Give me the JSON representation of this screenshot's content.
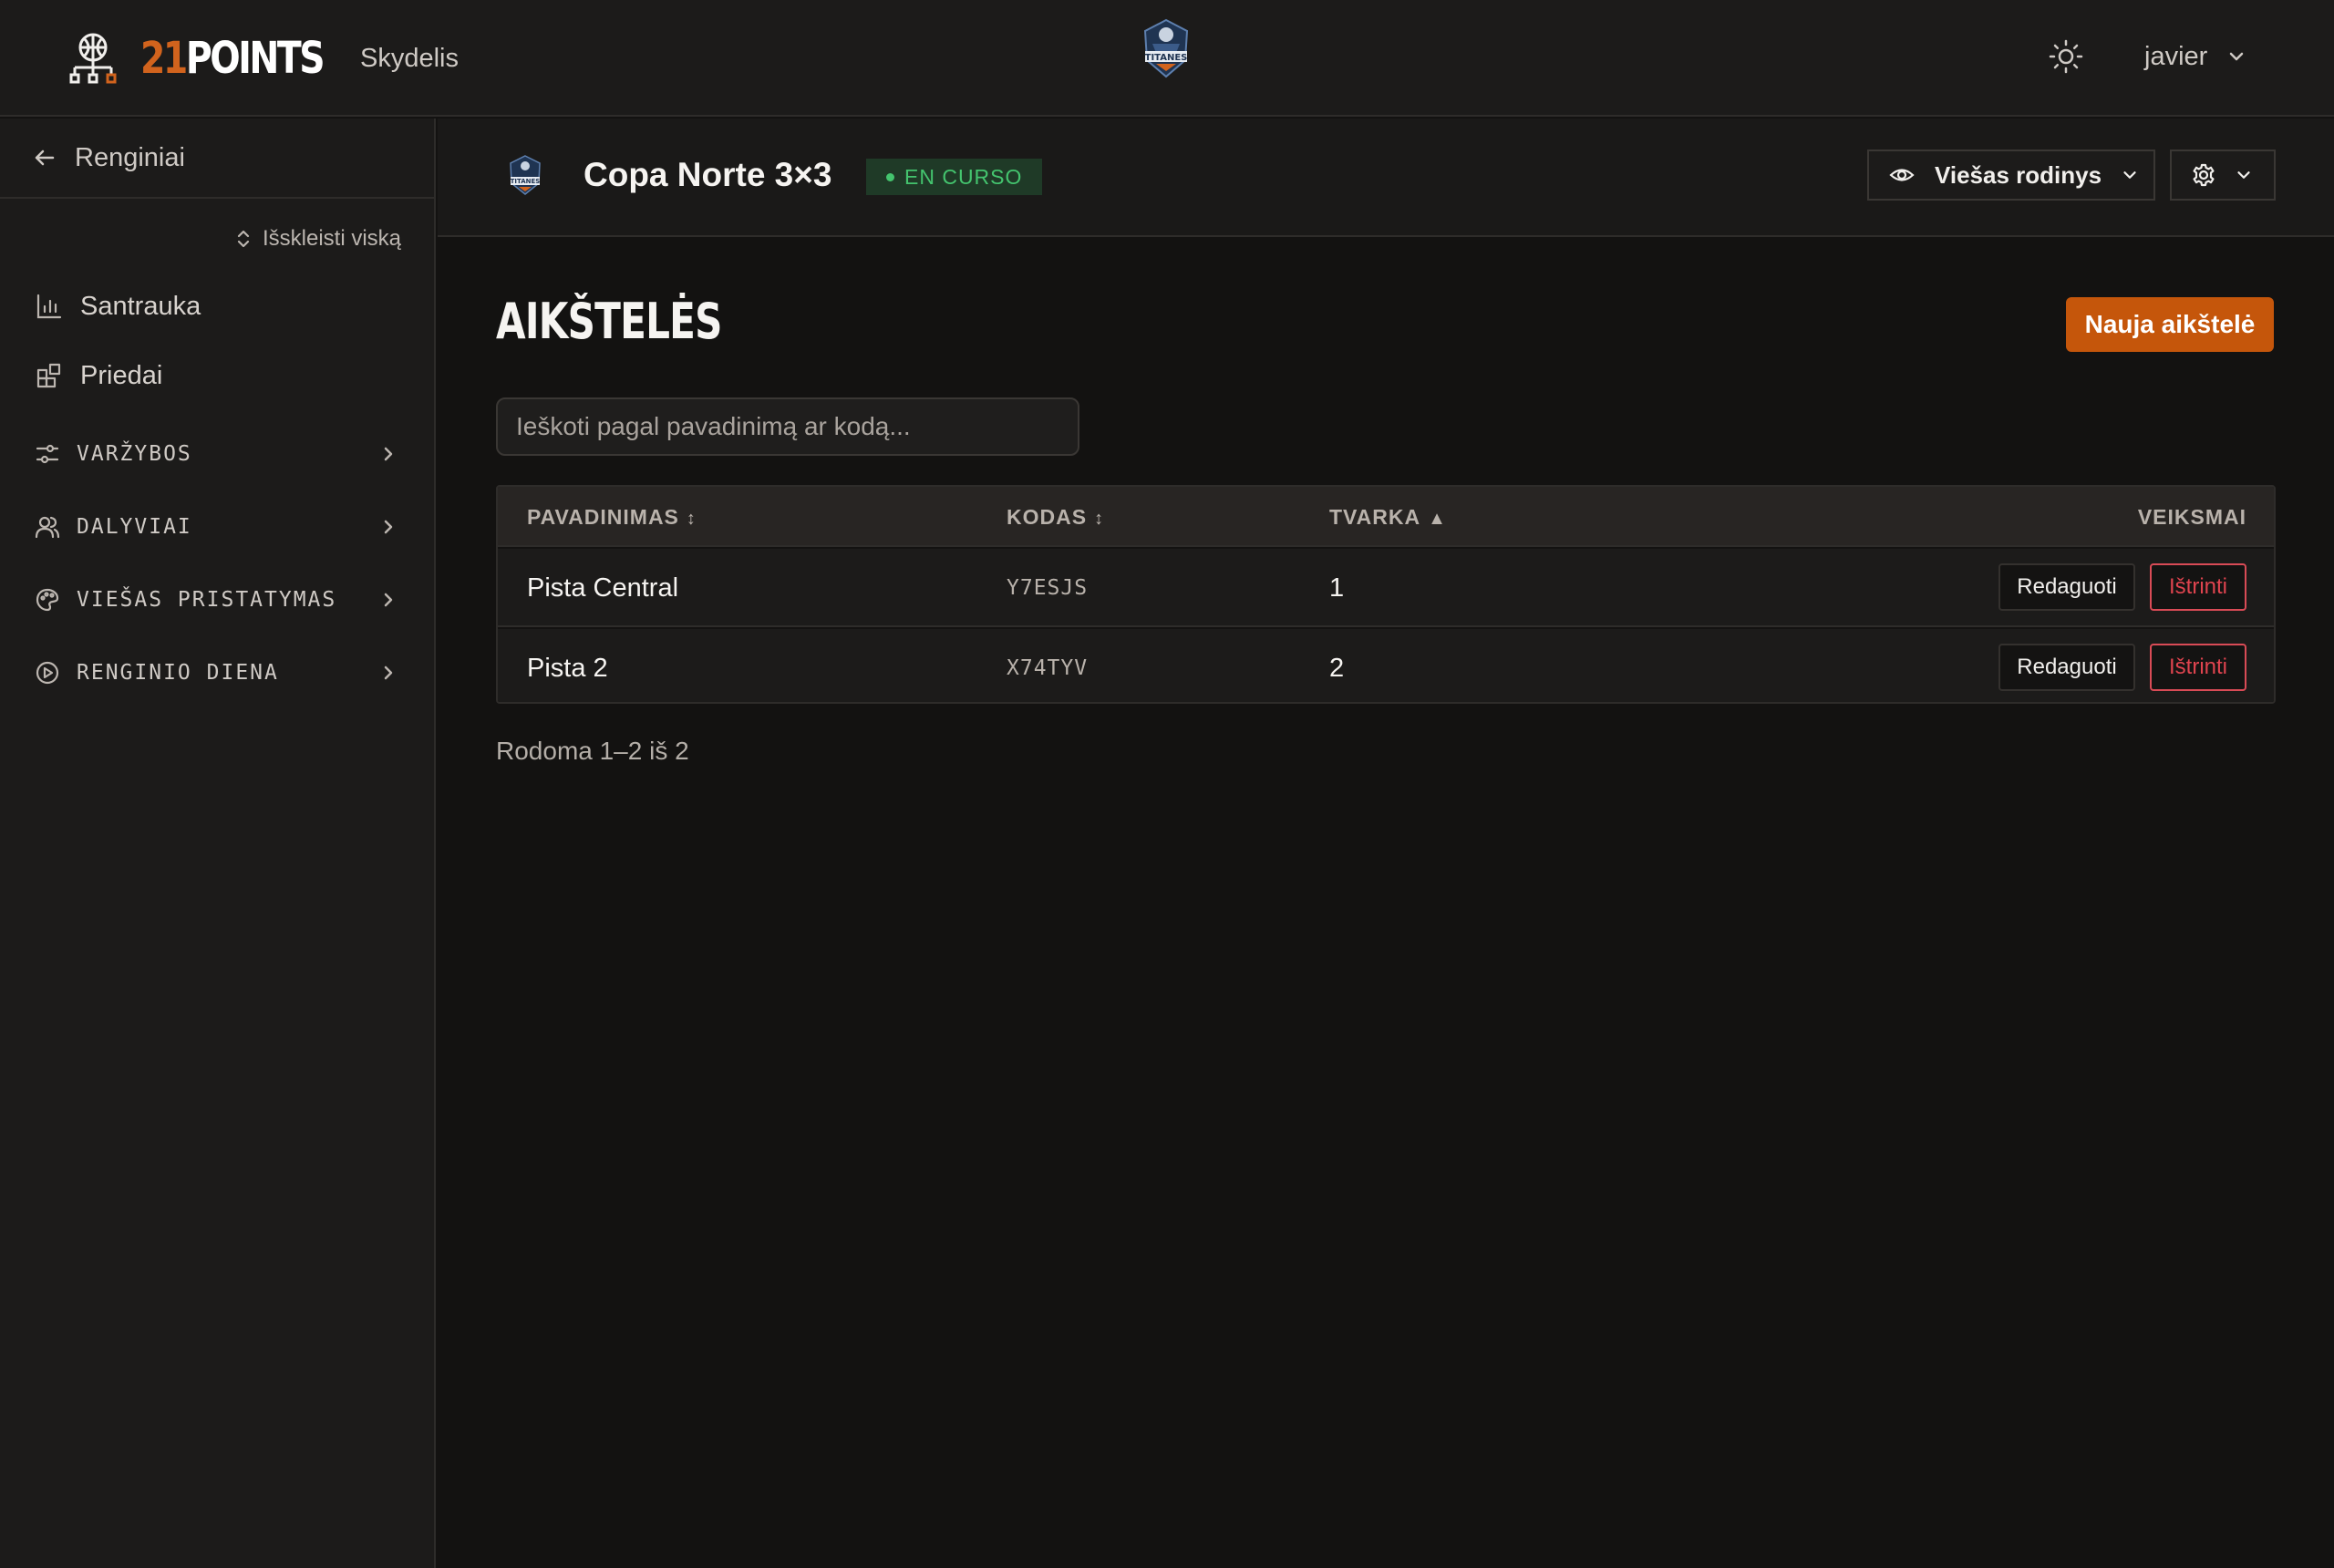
{
  "brand": {
    "prefix": "21",
    "suffix": "POINTS"
  },
  "header": {
    "nav_dashboard": "Skydelis",
    "user": "javier",
    "org_logo": "TITANES"
  },
  "sidebar": {
    "back_label": "Renginiai",
    "expand_all": "Išskleisti viską",
    "items": [
      {
        "label": "Santrauka",
        "icon": "bar-chart-icon"
      },
      {
        "label": "Priedai",
        "icon": "widgets-icon"
      }
    ],
    "sections": [
      {
        "label": "VARŽYBOS",
        "icon": "sliders-icon"
      },
      {
        "label": "DALYVIAI",
        "icon": "users-icon"
      },
      {
        "label": "VIEŠAS PRISTATYMAS",
        "icon": "palette-icon"
      },
      {
        "label": "RENGINIO DIENA",
        "icon": "play-circle-icon"
      }
    ]
  },
  "event": {
    "title": "Copa Norte 3×3",
    "status": "EN CURSO",
    "public_view_label": "Viešas rodinys",
    "logo": "TITANES"
  },
  "page": {
    "title": "AIKŠTELĖS",
    "new_button": "Nauja aikštelė",
    "search_placeholder": "Ieškoti pagal pavadinimą ar kodą..."
  },
  "table": {
    "columns": {
      "name": "PAVADINIMAS",
      "name_sort": "↕",
      "code": "KODAS",
      "code_sort": "↕",
      "order": "TVARKA",
      "order_sort": "▲",
      "actions": "VEIKSMAI"
    },
    "rows": [
      {
        "name": "Pista Central",
        "code": "Y7ESJS",
        "order": "1",
        "edit": "Redaguoti",
        "delete": "Ištrinti"
      },
      {
        "name": "Pista 2",
        "code": "X74TYV",
        "order": "2",
        "edit": "Redaguoti",
        "delete": "Ištrinti"
      }
    ]
  },
  "pagination": {
    "text": "Rodoma 1–2 iš 2"
  },
  "colors": {
    "accent": "#c5560b",
    "brand_orange": "#d1631d",
    "status_green": "#44c46e",
    "danger": "#e0444f"
  }
}
